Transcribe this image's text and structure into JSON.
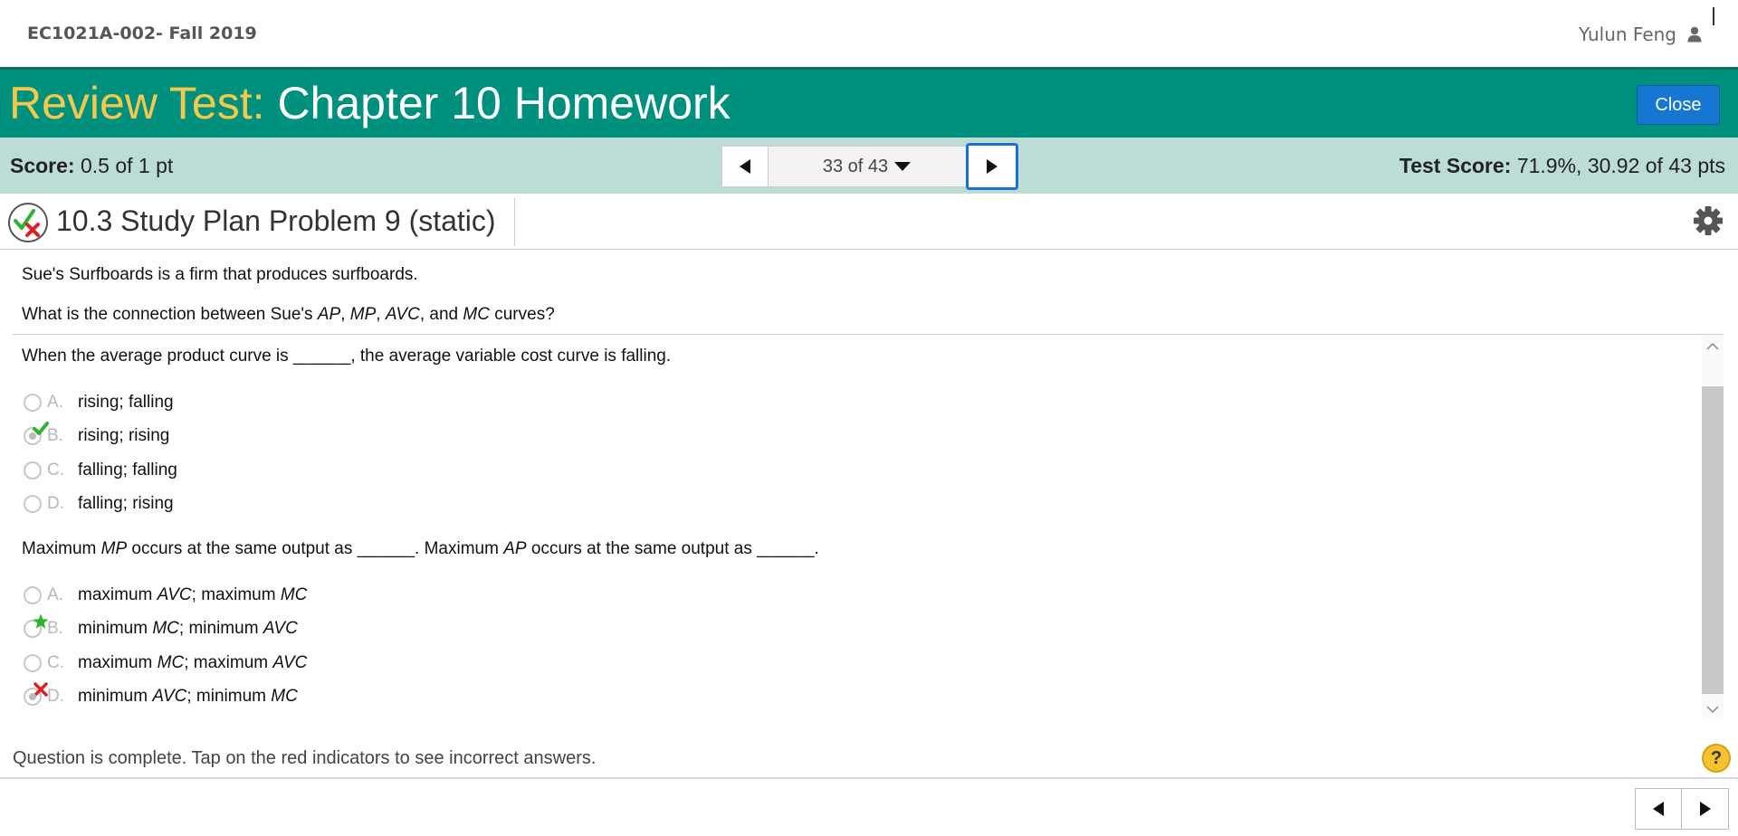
{
  "header": {
    "course": "EC1021A-002- Fall 2019",
    "user_name": "Yulun Feng",
    "user_icon": "user-icon"
  },
  "title_bar": {
    "lead": "Review Test:",
    "title": "Chapter 10 Homework",
    "close_label": "Close"
  },
  "score_bar": {
    "score_label": "Score:",
    "score_value": "0.5 of 1 pt",
    "nav_position": "33 of 43",
    "test_score_label": "Test Score:",
    "test_score_value": "71.9%, 30.92 of 43 pts"
  },
  "question": {
    "title": "10.3 Study Plan Problem 9 (static)",
    "status_icon": "partial-credit-icon",
    "settings_icon": "gear-icon",
    "statement_1": "Sue's Surfboards is a firm that produces surfboards.",
    "statement_2": {
      "before": "What is the connection between Sue's ",
      "ap": "AP",
      "sep1": ", ",
      "mp": "MP",
      "sep2": ", ",
      "avc": "AVC",
      "sep3": ", and ",
      "mc": "MC",
      "after": " curves?"
    }
  },
  "part1": {
    "prompt": "When the average product curve is ______, the average variable cost curve is falling.",
    "choices": [
      {
        "letter": "A.",
        "text": "rising; falling",
        "selected": false,
        "mark": ""
      },
      {
        "letter": "B.",
        "text": "rising; rising",
        "selected": true,
        "mark": "correct-check"
      },
      {
        "letter": "C.",
        "text": "falling; falling",
        "selected": false,
        "mark": ""
      },
      {
        "letter": "D.",
        "text": "falling; rising",
        "selected": false,
        "mark": ""
      }
    ]
  },
  "part2": {
    "prompt": {
      "p1": "Maximum ",
      "mp": "MP",
      "p2": " occurs at the same output as ______. Maximum ",
      "ap": "AP",
      "p3": " occurs at the same output as ______."
    },
    "choices": [
      {
        "letter": "A.",
        "t1": "maximum ",
        "i1": "AVC",
        "t2": "; maximum ",
        "i2": "MC",
        "selected": false,
        "mark": ""
      },
      {
        "letter": "B.",
        "t1": "minimum ",
        "i1": "MC",
        "t2": "; minimum ",
        "i2": "AVC",
        "selected": false,
        "mark": "correct-star"
      },
      {
        "letter": "C.",
        "t1": "maximum ",
        "i1": "MC",
        "t2": "; maximum ",
        "i2": "AVC",
        "selected": false,
        "mark": ""
      },
      {
        "letter": "D.",
        "t1": "minimum ",
        "i1": "AVC",
        "t2": "; minimum ",
        "i2": "MC",
        "selected": true,
        "mark": "incorrect-x"
      }
    ]
  },
  "footer": {
    "status_message": "Question is complete. Tap on the red indicators to see incorrect answers.",
    "help_label": "?"
  },
  "colors": {
    "title_bar": "#00907e",
    "title_lead": "#f2c94c",
    "score_bar": "#bcdcd6",
    "close_button": "#1677d2",
    "correct": "#2db52d",
    "incorrect": "#e02020"
  }
}
